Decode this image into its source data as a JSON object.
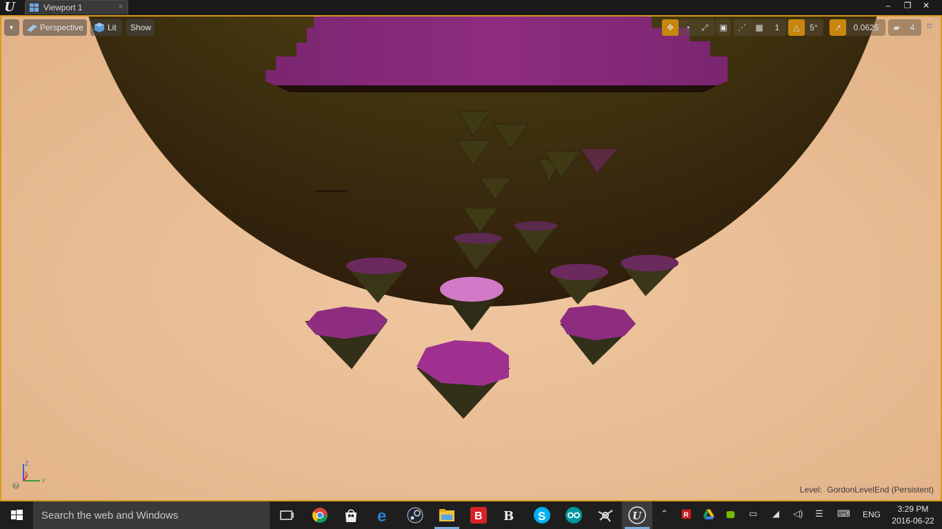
{
  "window": {
    "tab_title": "Viewport 1",
    "tab_close": "×",
    "minimize": "–",
    "maximize": "❐",
    "close": "✕"
  },
  "viewport": {
    "menu_glyph": "▼",
    "perspective_label": "Perspective",
    "lit_label": "Lit",
    "show_label": "Show",
    "transform_tools": [
      "move-icon",
      "rotate-icon",
      "scale-icon"
    ],
    "grid_snap_value": "1",
    "rotation_snap_value": "5°",
    "scale_snap_value": "0.0625",
    "camera_speed_value": "4",
    "accent_color": "#c8860d",
    "axis": {
      "z": "Z",
      "x": "X",
      "y": "Y"
    },
    "help_glyph": "?",
    "level_key": "Level:",
    "level_value": "GordonLevelEnd (Persistent)"
  },
  "taskbar": {
    "search_placeholder": "Search the web and Windows",
    "apps": [
      "task-view-icon",
      "chrome-icon",
      "store-icon",
      "edge-icon",
      "steam-icon",
      "file-explorer-icon",
      "b-app-icon",
      "b3-app-icon",
      "skype-icon",
      "arduino-icon",
      "blender-icon",
      "unreal-engine-icon"
    ],
    "tray_language": "ENG",
    "clock_time": "3:29 PM",
    "clock_date": "2016-06-22"
  }
}
